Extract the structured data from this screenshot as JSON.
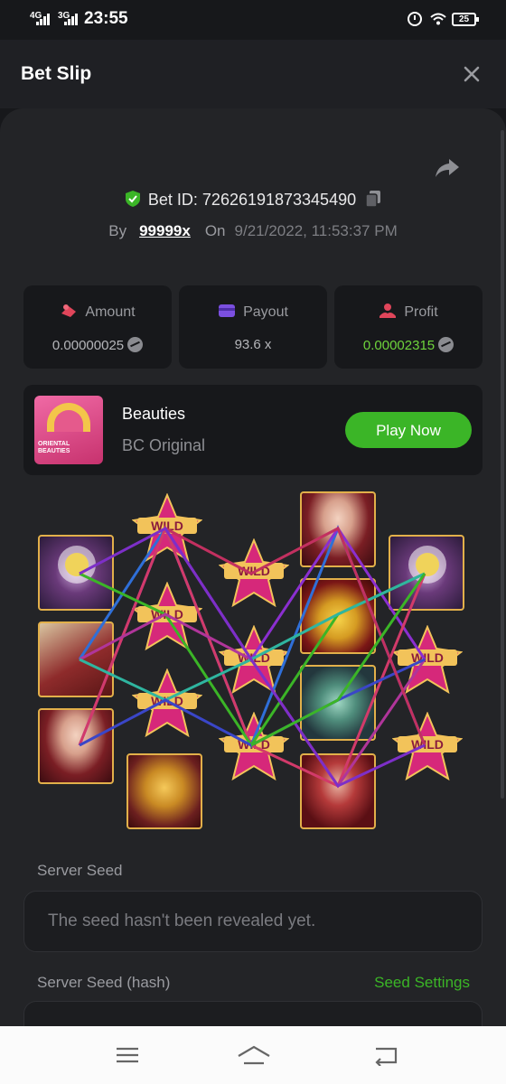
{
  "status_bar": {
    "net1": "4G",
    "net2": "3G",
    "time": "23:55",
    "battery": "25"
  },
  "header": {
    "title": "Bet Slip"
  },
  "bet": {
    "bet_id_label": "Bet ID:",
    "bet_id": "72626191873345490",
    "by_label": "By",
    "user": "99999x",
    "on_label": "On",
    "date": "9/21/2022, 11:53:37 PM"
  },
  "stats": {
    "amount_label": "Amount",
    "amount_value": "0.00000025",
    "payout_label": "Payout",
    "payout_value": "93.6 x",
    "profit_label": "Profit",
    "profit_value": "0.00002315"
  },
  "game": {
    "thumb_text": "ORIENTAL BEAUTIES",
    "name": "Beauties",
    "provider": "BC Original",
    "play_label": "Play Now"
  },
  "reels": {
    "wild_label": "WILD"
  },
  "seeds": {
    "server_seed_label": "Server Seed",
    "server_seed_value": "The seed hasn't been revealed yet.",
    "server_seed_hash_label": "Server Seed (hash)",
    "seed_settings_label": "Seed Settings"
  },
  "colors": {
    "accent_green": "#3bb527",
    "profit_green": "#6ed43c",
    "background": "#17181b",
    "card": "#232427"
  },
  "icons": {
    "shield": "shield-check-icon",
    "copy": "copy-icon",
    "share": "share-icon",
    "close": "close-icon",
    "amount": "amount-icon",
    "payout": "wallet-icon",
    "profit": "profit-icon",
    "coin": "coin-icon",
    "nav_menu": "menu-icon",
    "nav_home": "home-icon",
    "nav_back": "back-icon"
  }
}
